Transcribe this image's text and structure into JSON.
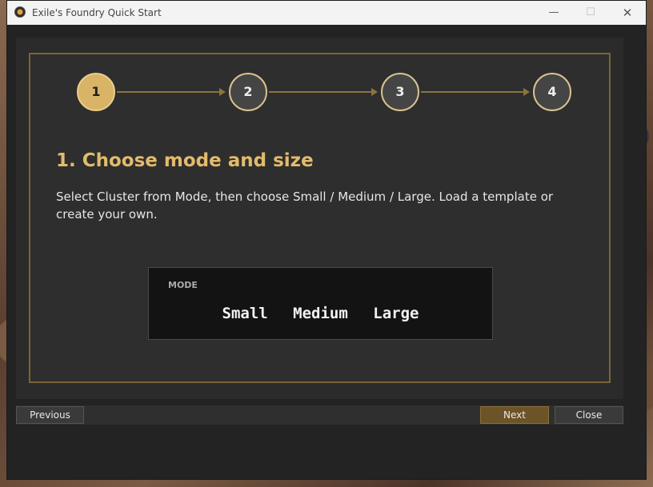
{
  "window": {
    "title": "Exile's Foundry Quick Start",
    "controls": {
      "minimize": "—",
      "maximize": "☐",
      "close": "✕"
    }
  },
  "steps": [
    {
      "number": "1",
      "active": true
    },
    {
      "number": "2",
      "active": false
    },
    {
      "number": "3",
      "active": false
    },
    {
      "number": "4",
      "active": false
    }
  ],
  "content": {
    "heading": "1. Choose mode and size",
    "description": "Select Cluster from Mode, then choose Small / Medium / Large. Load a template or create your own."
  },
  "mode_panel": {
    "label": "MODE",
    "options": [
      "Small",
      "Medium",
      "Large"
    ]
  },
  "footer": {
    "previous_label": "Previous",
    "next_label": "Next",
    "close_label": "Close"
  },
  "colors": {
    "accent_gold": "#d9b366",
    "heading_gold": "#e2bb6c",
    "panel_border": "#7a6535",
    "next_button": "#6c5428"
  }
}
